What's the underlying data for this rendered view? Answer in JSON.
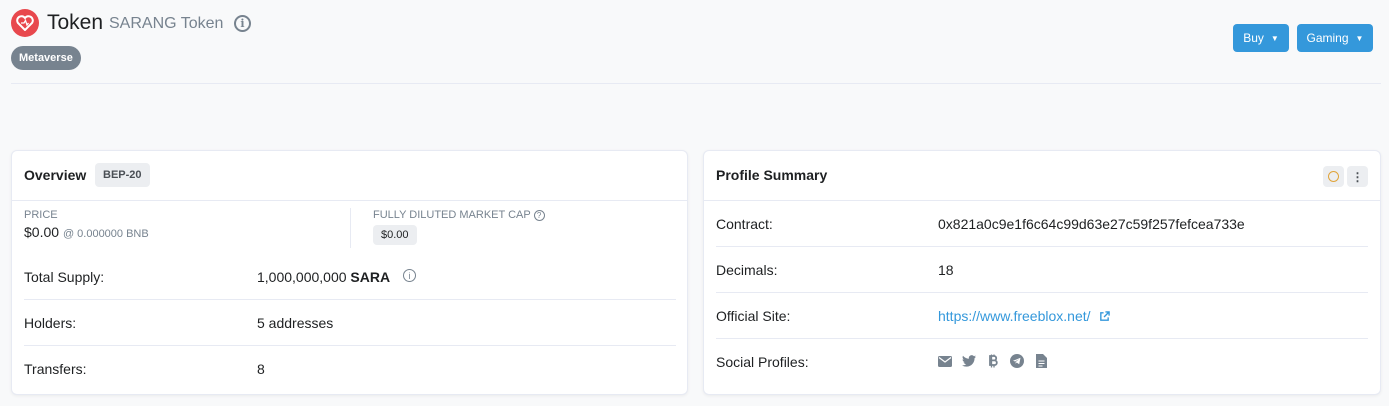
{
  "header": {
    "title": "Token",
    "token_name": "SARANG Token",
    "tag": "Metaverse",
    "buttons": [
      {
        "label": "Buy"
      },
      {
        "label": "Gaming"
      }
    ]
  },
  "overview": {
    "title": "Overview",
    "badge": "BEP-20",
    "price_label": "PRICE",
    "price_value": "$0.00",
    "price_bnb": "@ 0.000000 BNB",
    "fdmc_label": "FULLY DILUTED MARKET CAP",
    "fdmc_value": "$0.00",
    "rows": [
      {
        "label": "Total Supply:",
        "value": "1,000,000,000",
        "symbol": "SARA"
      },
      {
        "label": "Holders:",
        "value": "5 addresses"
      },
      {
        "label": "Transfers:",
        "value": "8"
      }
    ]
  },
  "profile": {
    "title": "Profile Summary",
    "contract_label": "Contract:",
    "contract_value": "0x821a0c9e1f6c64c99d63e27c59f257fefcea733e",
    "decimals_label": "Decimals:",
    "decimals_value": "18",
    "site_label": "Official Site:",
    "site_value": "https://www.freeblox.net/",
    "social_label": "Social Profiles:",
    "social_icons": [
      "email-icon",
      "twitter-icon",
      "bitcoin-icon",
      "telegram-icon",
      "document-icon"
    ]
  },
  "colors": {
    "accent": "#3498db",
    "logo": "#e8484d",
    "muted": "#77838f"
  }
}
